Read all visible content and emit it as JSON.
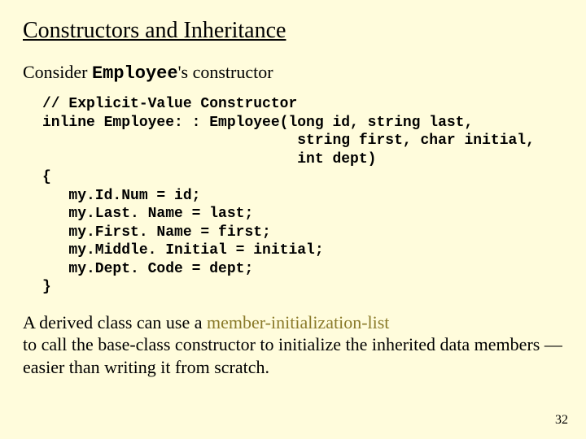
{
  "title": "Constructors and Inheritance",
  "subtitle_prefix": "Consider ",
  "subtitle_code": "Employee",
  "subtitle_suffix": "'s constructor",
  "code": "// Explicit-Value Constructor\ninline Employee: : Employee(long id, string last,\n                             string first, char initial,\n                             int dept)\n{\n   my.Id.Num = id;\n   my.Last. Name = last;\n   my.First. Name = first;\n   my.Middle. Initial = initial;\n   my.Dept. Code = dept;\n}",
  "paragraph_prefix": "A derived class can use a ",
  "paragraph_term": "member-initialization-list",
  "paragraph_suffix": "to call the base-class constructor to initialize the inherited data members — easier than writing it from scratch.",
  "page_number": "32"
}
